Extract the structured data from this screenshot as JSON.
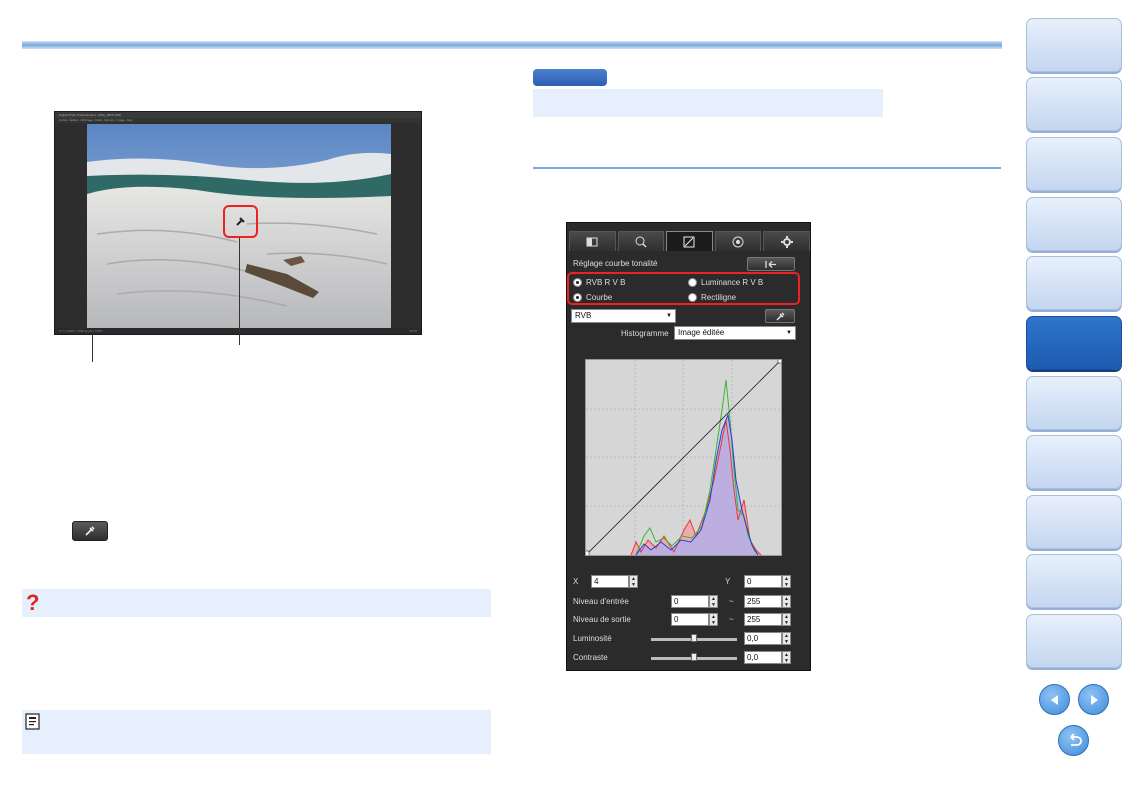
{
  "app_window": {
    "title": "Digital Photo Professional 4 - [IMG_0823.CR2]",
    "menu_items": [
      "Fichier",
      "Édition",
      "Affichage",
      "Outils",
      "Vignette",
      "Image",
      "Aide"
    ],
    "status_left": "0 / 1 | 3000 × 2000 pixels | 100%",
    "status_right": "00:00"
  },
  "panel": {
    "tabs": [
      "basic-tab",
      "detail-tab",
      "tone-curve-tab",
      "color-tab",
      "settings-tab"
    ],
    "header_title": "Réglage courbe tonalité",
    "mode_options": [
      {
        "label": "RVB R V B",
        "selected": true
      },
      {
        "label": "Luminance R V B",
        "selected": false
      },
      {
        "label": "Courbe",
        "selected": true
      },
      {
        "label": "Rectiligne",
        "selected": false
      }
    ],
    "channel_select": "RVB",
    "histogram_label": "Histogramme",
    "histogram_select": "Image éditée",
    "x_label": "X",
    "x_value": "4",
    "y_label": "Y",
    "y_value": "0",
    "input_level_label": "Niveau d'entrée",
    "input_level_min": "0",
    "input_level_max": "255",
    "output_level_label": "Niveau de sortie",
    "output_level_min": "0",
    "output_level_max": "255",
    "tilde": "~",
    "brightness_label": "Luminosité",
    "brightness_value": "0,0",
    "contrast_label": "Contraste",
    "contrast_value": "0,0"
  },
  "colors": {
    "accent": "#2f75cc",
    "highlight": "#e22222",
    "nav_light": "#c4d6f0"
  }
}
